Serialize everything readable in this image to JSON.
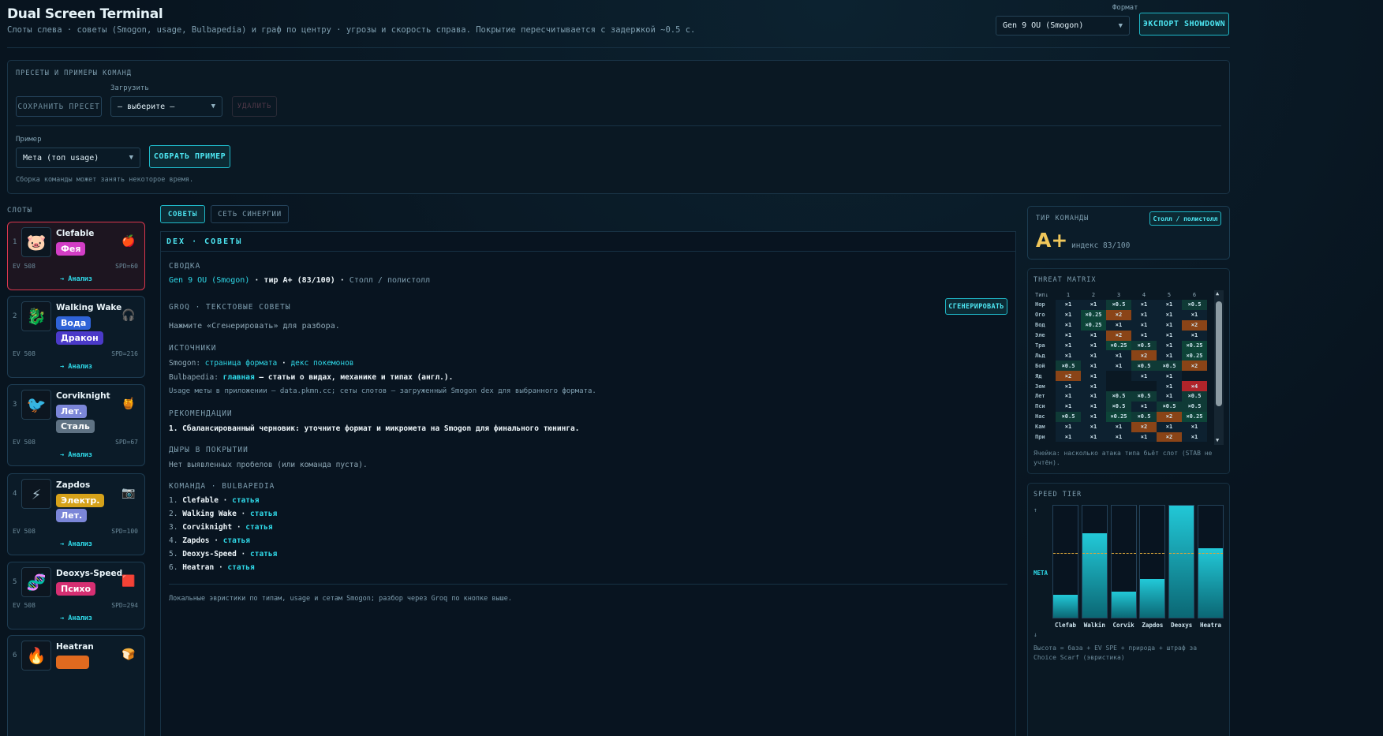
{
  "header": {
    "title": "Dual Screen Terminal",
    "subtitle": "Слоты слева · советы (Smogon, usage, Bulbapedia) и граф по центру · угрозы и скорость справа. Покрытие пересчитывается с задержкой ~0.5 с.",
    "format_label": "Формат",
    "format_value": "Gen 9 OU (Smogon)",
    "export_label": "ЭКСПОРТ SHOWDOWN"
  },
  "presets": {
    "title": "ПРЕСЕТЫ И ПРИМЕРЫ КОМАНД",
    "save_label": "СОХРАНИТЬ ПРЕСЕТ",
    "load_label": "Загрузить",
    "load_value": "— выберите —",
    "delete_label": "УДАЛИТЬ",
    "example_label": "Пример",
    "example_value": "Мета (топ usage)",
    "build_label": "СОБРАТЬ ПРИМЕР",
    "note": "Сборка команды может занять некоторое время."
  },
  "slots": {
    "title": "СЛОТЫ",
    "analyze": "→ Анализ",
    "ev": "EV 508",
    "items": [
      {
        "num": "1",
        "name": "Clefable",
        "types": [
          "Фея"
        ],
        "spd": "SPD=60"
      },
      {
        "num": "2",
        "name": "Walking Wake",
        "types": [
          "Вода",
          "Дракон"
        ],
        "spd": "SPD=216"
      },
      {
        "num": "3",
        "name": "Corviknight",
        "types": [
          "Лет.",
          "Сталь"
        ],
        "spd": "SPD=67"
      },
      {
        "num": "4",
        "name": "Zapdos",
        "types": [
          "Электр.",
          "Лет."
        ],
        "spd": "SPD=100"
      },
      {
        "num": "5",
        "name": "Deoxys-Speed",
        "types": [
          "Психо"
        ],
        "spd": "SPD=294"
      },
      {
        "num": "6",
        "name": "Heatran",
        "types": [],
        "spd": ""
      }
    ],
    "type_colors": {
      "Фея": "#d33ec6",
      "Вода": "#2f63d8",
      "Дракон": "#4b3ac9",
      "Лет.": "#7b86d8",
      "Сталь": "#5f7283",
      "Электр.": "#d6a21a",
      "Психо": "#d62f72",
      "Огонь": "#e06a1f"
    }
  },
  "tabs": {
    "advice": "СОВЕТЫ",
    "synergy": "СЕТЬ СИНЕРГИИ"
  },
  "dex": {
    "title": "DEX · СОВЕТЫ",
    "summary_label": "СВОДКА",
    "summary_format": "Gen 9 OU (Smogon)",
    "summary_sep": " · ",
    "summary_tier": "тир A+ (83/100)",
    "summary_role": "Столл / полистолл",
    "groq_label": "GROQ · ТЕКСТОВЫЕ СОВЕТЫ",
    "generate_label": "СГЕНЕРИРОВАТЬ",
    "groq_hint": "Нажмите «Сгенерировать» для разбора.",
    "sources_label": "ИСТОЧНИКИ",
    "smogon_prefix": "Smogon: ",
    "smogon_link1": "страница формата",
    "smogon_link2": "декс покемонов",
    "bulba_prefix": "Bulbapedia: ",
    "bulba_link": "главная",
    "bulba_rest": " — статьи о видах, механике и типах (англ.).",
    "usage_note": "Usage меты в приложении — data.pkmn.cc; сеты слотов — загруженный Smogon dex для выбранного формата.",
    "rec_label": "РЕКОМЕНДАЦИИ",
    "rec_1": "1.  Сбалансированный черновик: уточните формат и микромета на Smogon для финального тюнинга.",
    "gaps_label": "ДЫРЫ В ПОКРЫТИИ",
    "gaps_text": "Нет выявленных пробелов (или команда пуста).",
    "team_label": "КОМАНДА · BULBAPEDIA",
    "article": "статья",
    "team": [
      {
        "n": "1.",
        "name": "Clefable"
      },
      {
        "n": "2.",
        "name": "Walking Wake"
      },
      {
        "n": "3.",
        "name": "Corviknight"
      },
      {
        "n": "4.",
        "name": "Zapdos"
      },
      {
        "n": "5.",
        "name": "Deoxys-Speed"
      },
      {
        "n": "6.",
        "name": "Heatran"
      }
    ],
    "footer": "Локальные эвристики по типам, usage и сетам Smogon; разбор через Groq по кнопке выше."
  },
  "tier": {
    "label": "ТИР КОМАНДЫ",
    "role": "Столл / полистолл",
    "grade": "A+",
    "index": "индекс 83/100"
  },
  "threat": {
    "label": "THREAT MATRIX",
    "corner": "Тип↓",
    "cols": [
      "1",
      "2",
      "3",
      "4",
      "5",
      "6"
    ],
    "rows": [
      {
        "t": "Нор",
        "v": [
          "×1",
          "×1",
          "×0.5",
          "×1",
          "×1",
          "×0.5"
        ]
      },
      {
        "t": "Ого",
        "v": [
          "×1",
          "×0.25",
          "×2",
          "×1",
          "×1",
          "×1"
        ]
      },
      {
        "t": "Вод",
        "v": [
          "×1",
          "×0.25",
          "×1",
          "×1",
          "×1",
          "×2"
        ]
      },
      {
        "t": "Эле",
        "v": [
          "×1",
          "×1",
          "×2",
          "×1",
          "×1",
          "×1"
        ]
      },
      {
        "t": "Тра",
        "v": [
          "×1",
          "×1",
          "×0.25",
          "×0.5",
          "×1",
          "×0.25"
        ]
      },
      {
        "t": "Льд",
        "v": [
          "×1",
          "×1",
          "×1",
          "×2",
          "×1",
          "×0.25"
        ]
      },
      {
        "t": "Бой",
        "v": [
          "×0.5",
          "×1",
          "×1",
          "×0.5",
          "×0.5",
          "×2"
        ]
      },
      {
        "t": "Яд",
        "v": [
          "×2",
          "×1",
          "",
          "×1",
          "×1",
          ""
        ]
      },
      {
        "t": "Зем",
        "v": [
          "×1",
          "×1",
          "",
          "",
          "×1",
          "×4"
        ]
      },
      {
        "t": "Лет",
        "v": [
          "×1",
          "×1",
          "×0.5",
          "×0.5",
          "×1",
          "×0.5"
        ]
      },
      {
        "t": "Пси",
        "v": [
          "×1",
          "×1",
          "×0.5",
          "×1",
          "×0.5",
          "×0.5"
        ]
      },
      {
        "t": "Нас",
        "v": [
          "×0.5",
          "×1",
          "×0.25",
          "×0.5",
          "×2",
          "×0.25"
        ]
      },
      {
        "t": "Кам",
        "v": [
          "×1",
          "×1",
          "×1",
          "×2",
          "×1",
          "×1"
        ]
      },
      {
        "t": "При",
        "v": [
          "×1",
          "×1",
          "×1",
          "×1",
          "×2",
          "×1"
        ]
      }
    ],
    "note": "Ячейка: насколько атака типа бьёт слот (STAB не учтён)."
  },
  "speed": {
    "label": "SPEED TIER",
    "meta_label": "МЕТА",
    "up": "↑",
    "down": "↓",
    "note": "Высота = база + EV SPE + природа + штраф за Choice Scarf (эвристика)",
    "bars": [
      {
        "name": "Clefab",
        "level": 0.2
      },
      {
        "name": "Walkin",
        "level": 0.74
      },
      {
        "name": "Corvik",
        "level": 0.23
      },
      {
        "name": "Zapdos",
        "level": 0.34
      },
      {
        "name": "Deoxys",
        "level": 1.0
      },
      {
        "name": "Heatra",
        "level": 0.61
      }
    ],
    "meta_level": 0.56
  }
}
